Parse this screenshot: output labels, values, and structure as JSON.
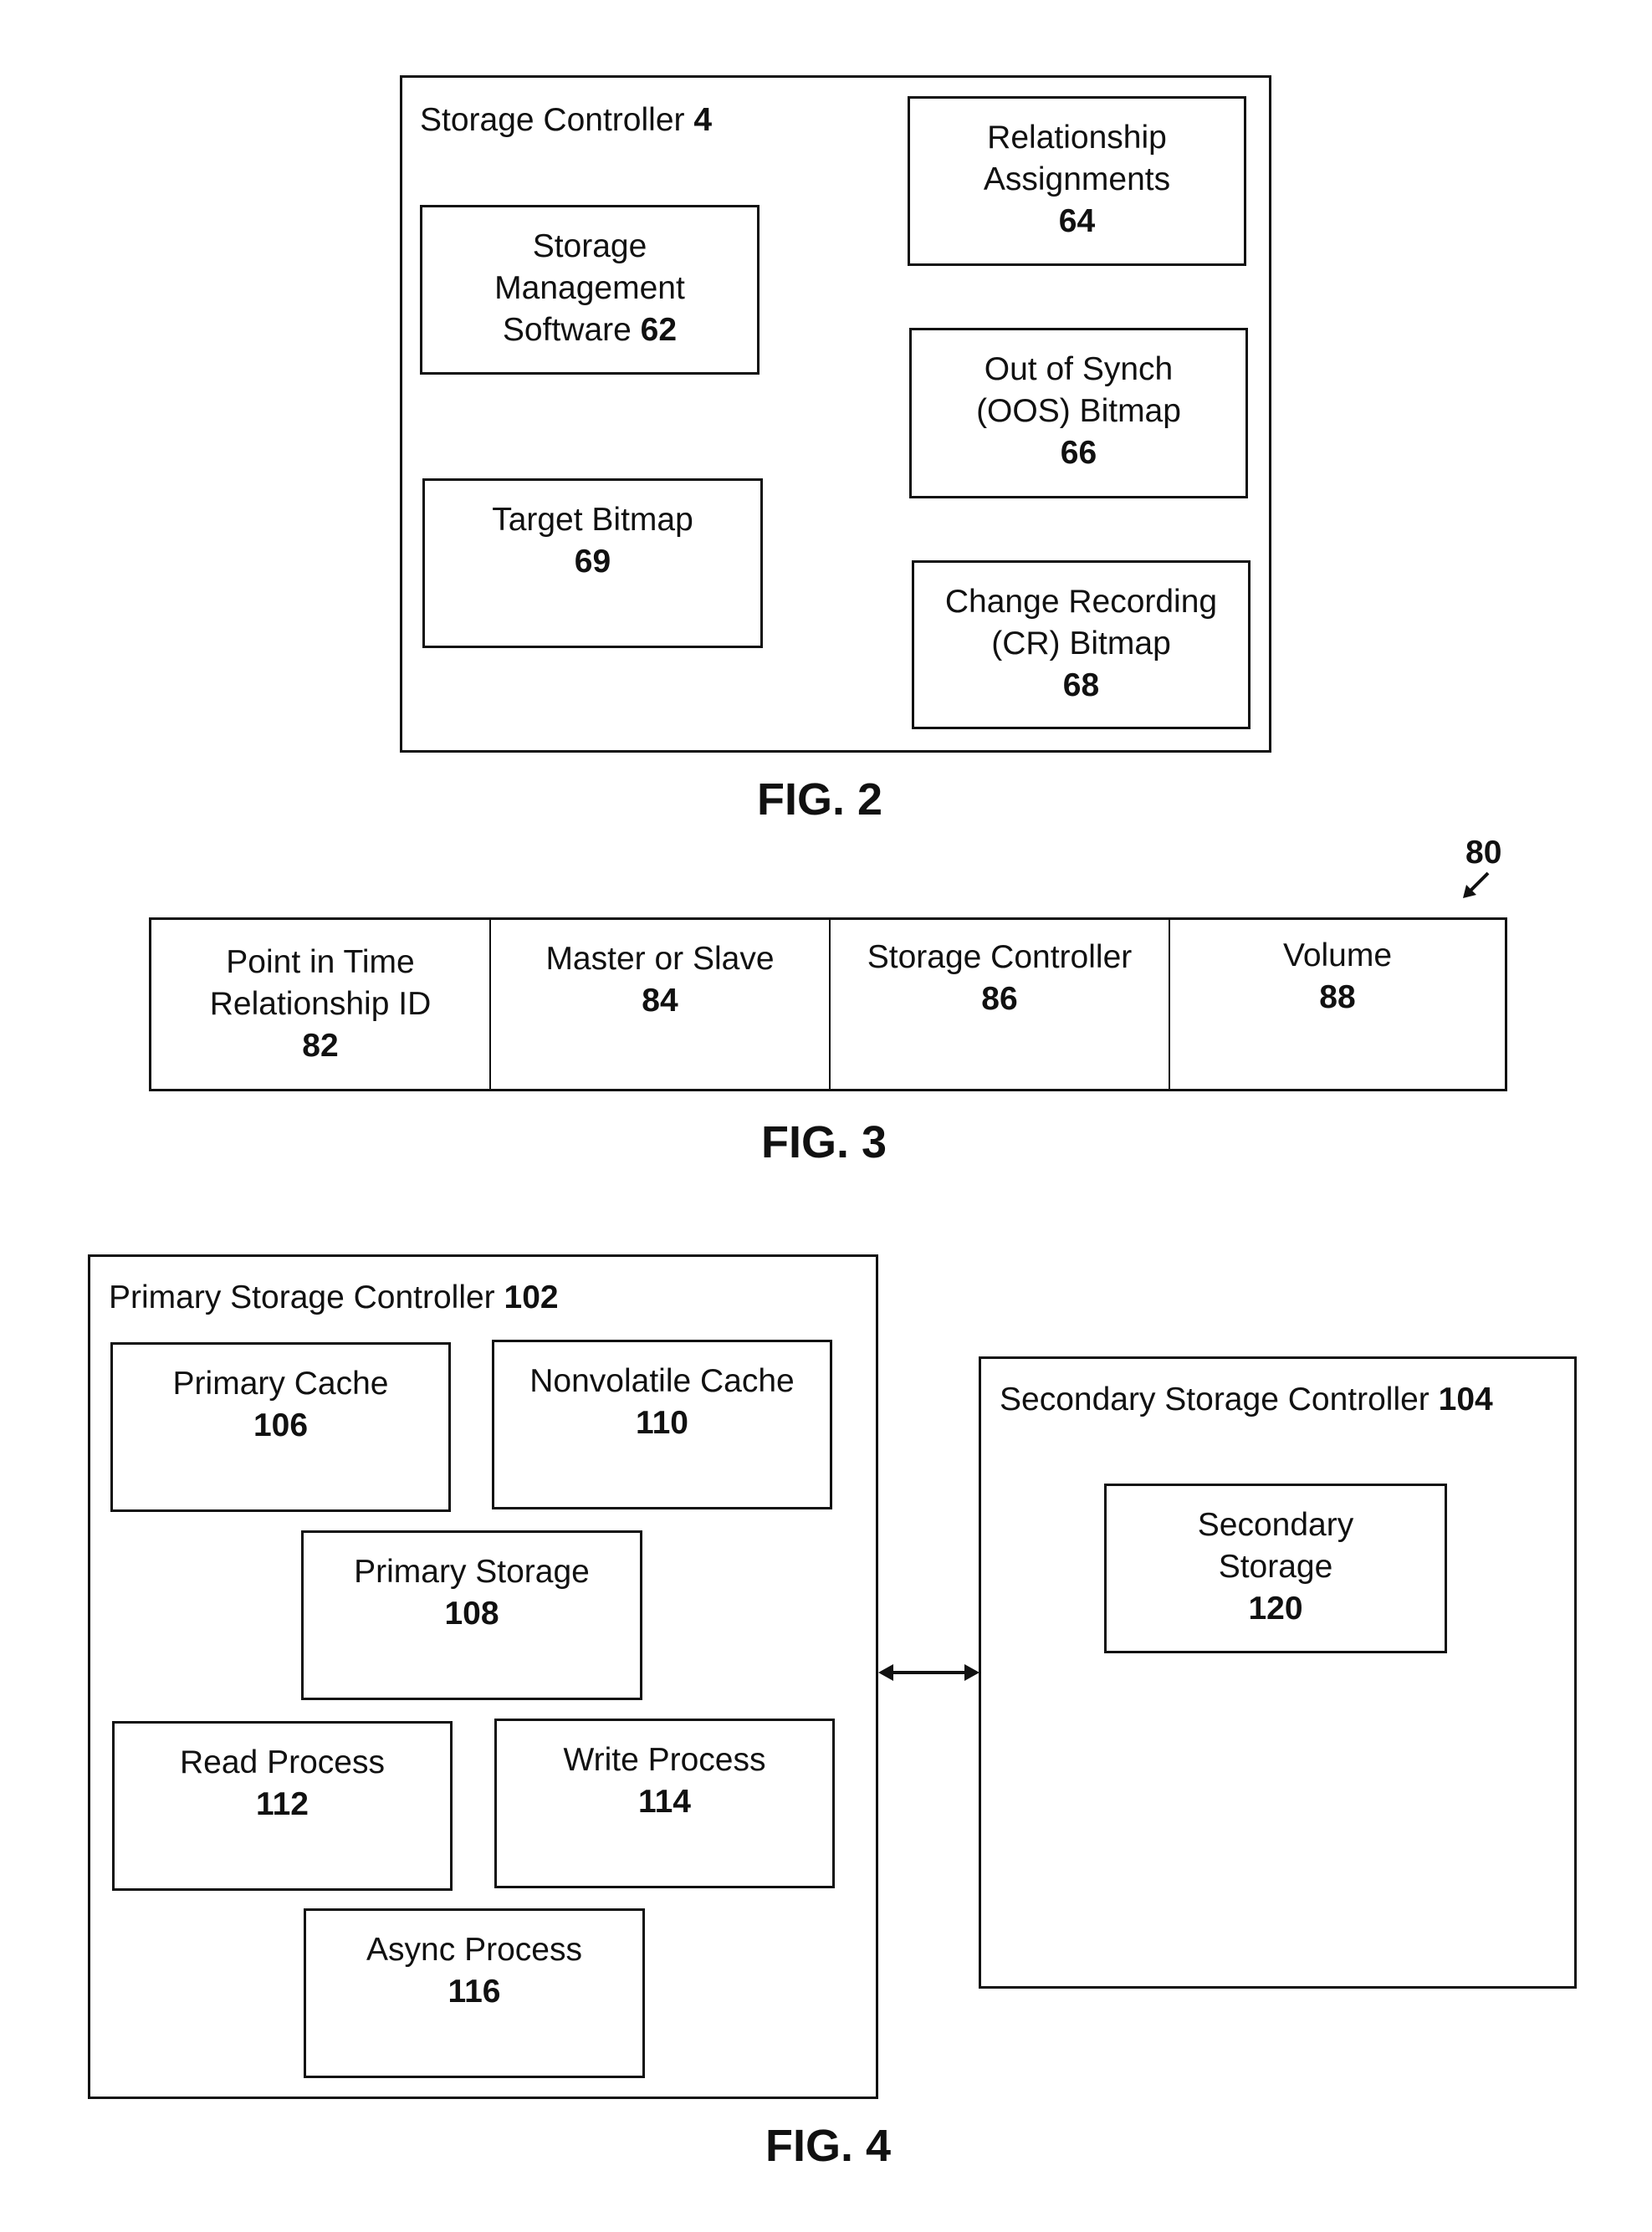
{
  "fig2": {
    "caption": "FIG. 2",
    "container": {
      "label": "Storage Controller",
      "ref": "4"
    },
    "boxes": [
      {
        "lines": [
          "Storage",
          "Management"
        ],
        "last_line": "Software",
        "ref": "62",
        "ref_inline": true
      },
      {
        "lines": [
          "Relationship",
          "Assignments"
        ],
        "ref": "64"
      },
      {
        "lines": [
          "Target Bitmap"
        ],
        "ref": "69"
      },
      {
        "lines": [
          "Out of Synch",
          "(OOS) Bitmap"
        ],
        "ref": "66"
      },
      {
        "lines": [
          "Change Recording",
          "(CR) Bitmap"
        ],
        "ref": "68"
      }
    ]
  },
  "fig3": {
    "caption": "FIG. 3",
    "ref": "80",
    "fields": [
      {
        "line1": "Point in Time",
        "line2": "Relationship ID",
        "ref": "82"
      },
      {
        "line1": "Master or Slave",
        "ref": "84"
      },
      {
        "line1": "Storage Controller",
        "ref": "86"
      },
      {
        "line1": "Volume",
        "ref": "88"
      }
    ]
  },
  "fig4": {
    "caption": "FIG. 4",
    "primary": {
      "label": "Primary Storage Controller",
      "ref": "102"
    },
    "secondary": {
      "label": "Secondary Storage Controller",
      "ref": "104"
    },
    "primary_boxes": [
      {
        "label": "Primary Cache",
        "ref": "106"
      },
      {
        "label": "Nonvolatile Cache",
        "ref": "110"
      },
      {
        "label": "Primary Storage",
        "ref": "108"
      },
      {
        "label": "Read Process",
        "ref": "112"
      },
      {
        "label": "Write Process",
        "ref": "114"
      },
      {
        "label": "Async Process",
        "ref": "116"
      }
    ],
    "secondary_box": {
      "line1": "Secondary",
      "line2": "Storage",
      "ref": "120"
    }
  }
}
